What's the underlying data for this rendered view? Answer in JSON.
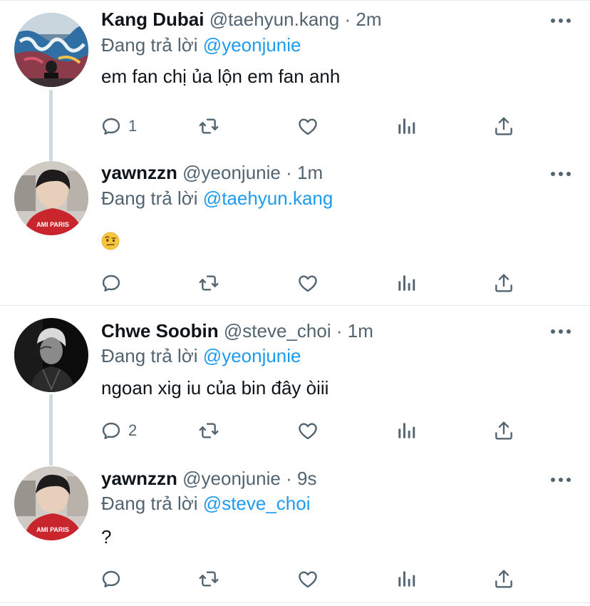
{
  "reply_prefix": "Đang trả lời",
  "tweets": [
    {
      "name": "Kang Dubai",
      "handle": "@taehyun.kang",
      "separator": "·",
      "time": "2m",
      "reply_to": "@yeonjunie",
      "text": "em fan chị ủa lộn em fan anh",
      "reply_count": "1",
      "avatar": "graffiti-wall-avatar"
    },
    {
      "name": "yawnzzn",
      "handle": "@yeonjunie",
      "separator": "·",
      "time": "1m",
      "reply_to": "@taehyun.kang",
      "text": "",
      "emoji": "face-with-raised-eyebrow",
      "reply_count": "",
      "avatar": "red-hoodie-avatar"
    },
    {
      "name": "Chwe Soobin",
      "handle": "@steve_choi",
      "separator": "·",
      "time": "1m",
      "reply_to": "@yeonjunie",
      "text": "ngoan xig iu của bin đây òiii",
      "reply_count": "2",
      "avatar": "monochrome-portrait-avatar"
    },
    {
      "name": "yawnzzn",
      "handle": "@yeonjunie",
      "separator": "·",
      "time": "9s",
      "reply_to": "@steve_choi",
      "text": "?",
      "reply_count": "",
      "avatar": "red-hoodie-avatar"
    }
  ],
  "colors": {
    "accent": "#1d9bf0",
    "secondary_text": "#536471",
    "primary_text": "#0f1419",
    "divider": "#e1e8ed",
    "thread_line": "#cfd9de"
  },
  "icons": [
    "more-icon",
    "reply-icon",
    "retweet-icon",
    "like-icon",
    "analytics-icon",
    "share-icon"
  ]
}
